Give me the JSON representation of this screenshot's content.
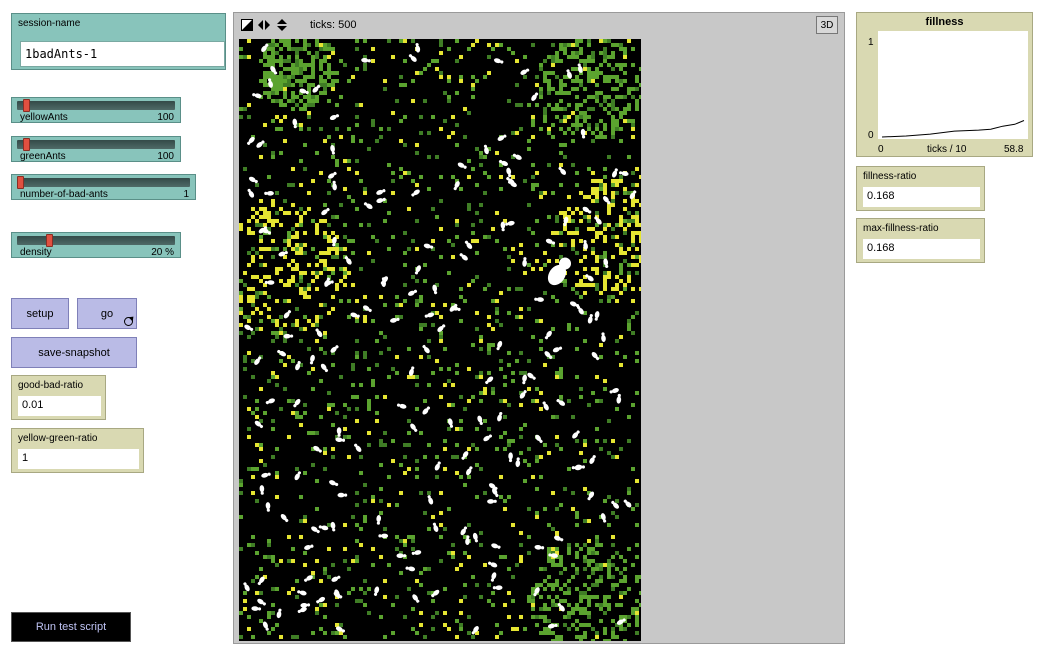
{
  "session": {
    "label": "session-name",
    "value": "1badAnts-1"
  },
  "sliders": [
    {
      "name": "yellowAnts",
      "value": "100",
      "fraction": 0.0
    },
    {
      "name": "greenAnts",
      "value": "100",
      "fraction": 0.0
    },
    {
      "name": "number-of-bad-ants",
      "value": "1",
      "fraction": 0.0
    },
    {
      "name": "density",
      "value": "20 %",
      "fraction": 0.2
    }
  ],
  "buttons": {
    "setup": "setup",
    "go": "go",
    "save_snapshot": "save-snapshot",
    "test_script": "Run test script"
  },
  "monitors": {
    "good_bad_ratio": {
      "label": "good-bad-ratio",
      "value": "0.01"
    },
    "yellow_green_ratio": {
      "label": "yellow-green-ratio",
      "value": "1"
    },
    "fillness_ratio": {
      "label": "fillness-ratio",
      "value": "0.168"
    },
    "max_fillness_ratio": {
      "label": "max-fillness-ratio",
      "value": "0.168"
    }
  },
  "view": {
    "ticks_label": "ticks: 500",
    "btn_3d": "3D"
  },
  "colors": {
    "patch_yellow": "#e5e532",
    "patch_green": "#5ba32f",
    "patch_dark_green": "#3f7d25",
    "ant": "#ffffff",
    "background": "#000000"
  },
  "chart_data": {
    "type": "line",
    "title": "fillness",
    "xlabel": "ticks / 10",
    "ylabel": "",
    "xlim": [
      0,
      58.8
    ],
    "ylim": [
      0,
      1
    ],
    "x_ticks": [
      "0",
      "58.8"
    ],
    "y_ticks": [
      "0",
      "1"
    ],
    "series": [
      {
        "x": [
          0,
          10,
          20,
          30,
          40,
          45,
          50,
          55,
          58.8
        ],
        "y": [
          0.0,
          0.01,
          0.03,
          0.06,
          0.07,
          0.08,
          0.11,
          0.13,
          0.168
        ]
      }
    ]
  }
}
